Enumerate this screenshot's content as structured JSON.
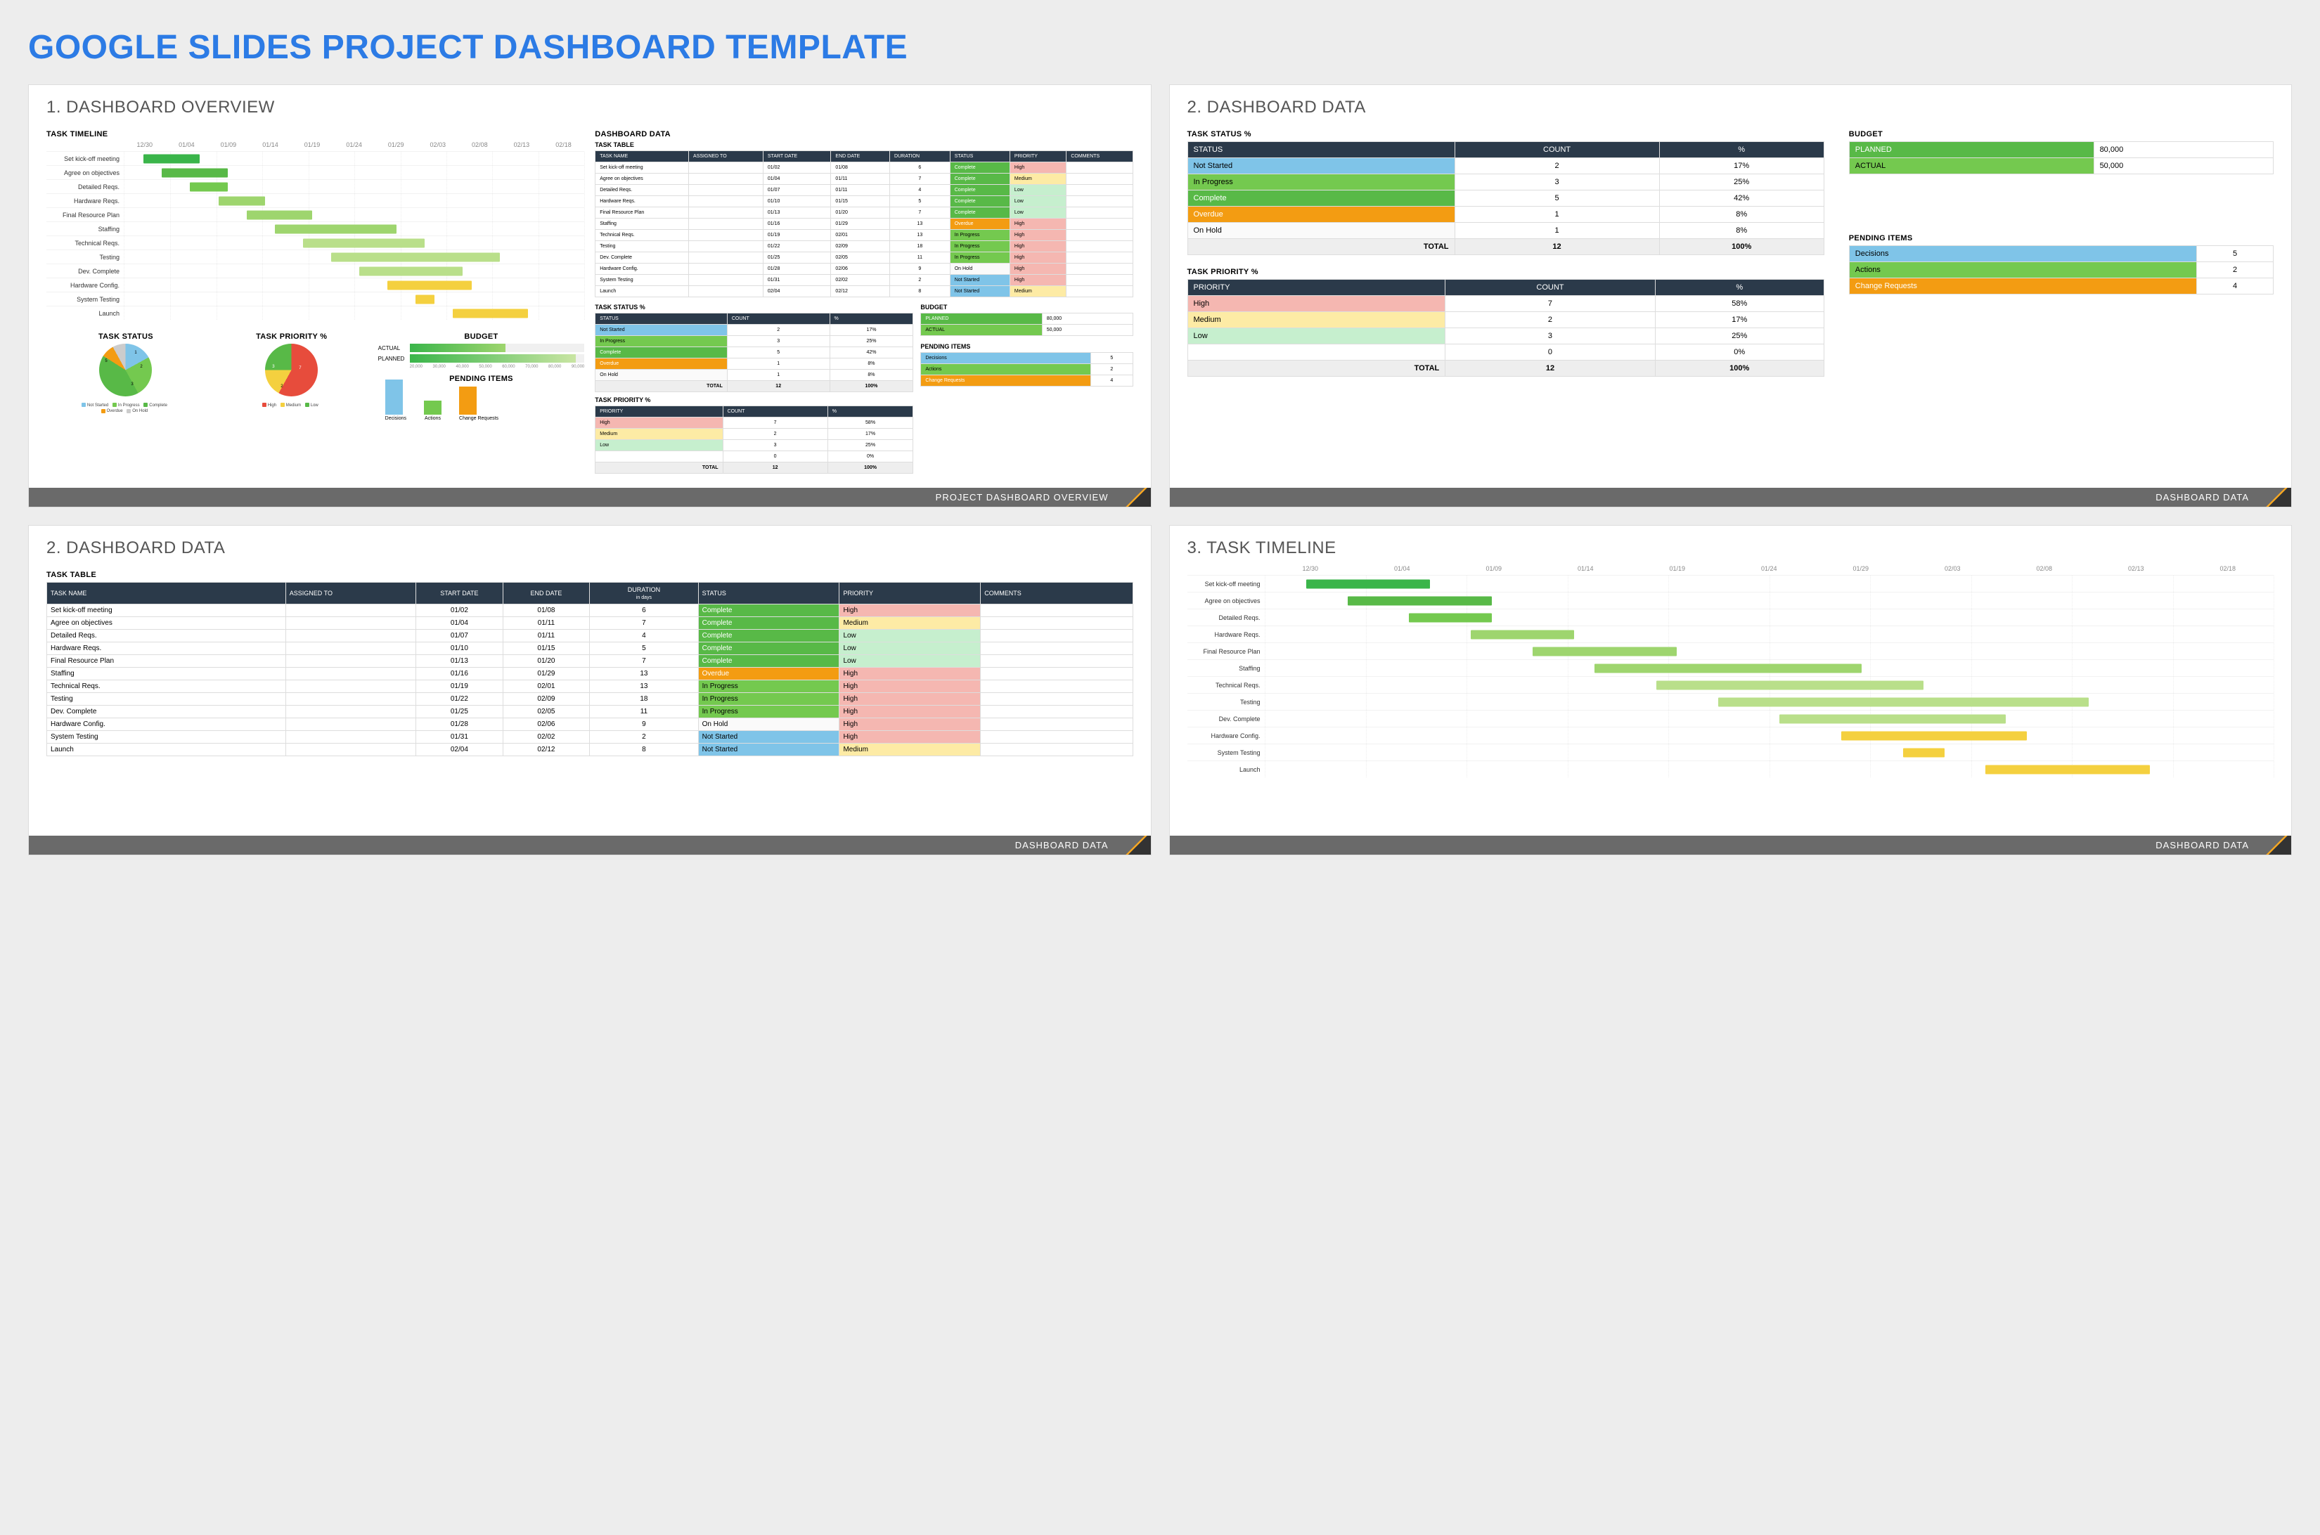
{
  "page_title": "GOOGLE SLIDES PROJECT DASHBOARD TEMPLATE",
  "colors": {
    "status": {
      "Not Started": "#7FC4E8",
      "In Progress": "#74C94F",
      "Complete": "#58B947",
      "Overdue": "#F39C12",
      "On Hold": "#FAFAFA"
    },
    "priority": {
      "High": "#F5B7B1",
      "Medium": "#FDEBA5",
      "Low": "#C6EFCE"
    },
    "gantt": [
      "#3AB54A",
      "#58B947",
      "#74C94F",
      "#9ED56E",
      "#9ED56E",
      "#9ED56E",
      "#B9DF8A",
      "#B9DF8A",
      "#B9DF8A",
      "#F4D03F",
      "#F4D03F",
      "#F4D03F"
    ]
  },
  "panels": {
    "overview": {
      "title": "1. DASHBOARD OVERVIEW",
      "footer": "PROJECT DASHBOARD OVERVIEW",
      "sections": {
        "timeline": "TASK TIMELINE",
        "data": "DASHBOARD DATA",
        "status": "TASK STATUS",
        "priority": "TASK PRIORITY %",
        "budget": "BUDGET",
        "pending": "PENDING ITEMS",
        "status_pct": "TASK STATUS %",
        "priority_pct": "TASK PRIORITY %",
        "task_table": "TASK TABLE"
      },
      "budget_axis": [
        "20,000",
        "30,000",
        "40,000",
        "50,000",
        "60,000",
        "70,000",
        "80,000",
        "90,000"
      ],
      "budget_bars": {
        "ACTUAL": "ACTUAL",
        "PLANNED": "PLANNED"
      },
      "legend_status": [
        "Not Started",
        "In Progress",
        "Complete",
        "Overdue",
        "On Hold"
      ],
      "legend_priority": [
        "High",
        "Medium",
        "Low"
      ],
      "pending_labels": [
        "Decisions",
        "Actions",
        "Change Requests"
      ]
    },
    "data_right": {
      "title": "2. DASHBOARD DATA",
      "footer": "DASHBOARD DATA",
      "task_status": {
        "heading": "TASK STATUS %",
        "cols": [
          "STATUS",
          "COUNT",
          "%"
        ],
        "rows": [
          {
            "status": "Not Started",
            "count": 2,
            "pct": "17%",
            "cls": "status-notstarted"
          },
          {
            "status": "In Progress",
            "count": 3,
            "pct": "25%",
            "cls": "status-inprogress"
          },
          {
            "status": "Complete",
            "count": 5,
            "pct": "42%",
            "cls": "status-complete"
          },
          {
            "status": "Overdue",
            "count": 1,
            "pct": "8%",
            "cls": "status-overdue"
          },
          {
            "status": "On Hold",
            "count": 1,
            "pct": "8%",
            "cls": "status-onhold"
          }
        ],
        "total_label": "TOTAL",
        "total_count": 12,
        "total_pct": "100%"
      },
      "task_priority": {
        "heading": "TASK PRIORITY %",
        "cols": [
          "PRIORITY",
          "COUNT",
          "%"
        ],
        "rows": [
          {
            "priority": "High",
            "count": 7,
            "pct": "58%",
            "cls": "prio-high"
          },
          {
            "priority": "Medium",
            "count": 2,
            "pct": "17%",
            "cls": "prio-med"
          },
          {
            "priority": "Low",
            "count": 3,
            "pct": "25%",
            "cls": "prio-low"
          },
          {
            "priority": "",
            "count": 0,
            "pct": "0%",
            "cls": ""
          }
        ],
        "total_label": "TOTAL",
        "total_count": 12,
        "total_pct": "100%"
      },
      "budget": {
        "heading": "BUDGET",
        "rows": [
          {
            "label": "PLANNED",
            "value": "80,000",
            "cls": "budget-planned"
          },
          {
            "label": "ACTUAL",
            "value": "50,000",
            "cls": "budget-actual"
          }
        ]
      },
      "pending": {
        "heading": "PENDING ITEMS",
        "rows": [
          {
            "label": "Decisions",
            "value": 5,
            "cls": "pi-dec"
          },
          {
            "label": "Actions",
            "value": 2,
            "cls": "pi-act"
          },
          {
            "label": "Change Requests",
            "value": 4,
            "cls": "pi-chg"
          }
        ]
      }
    },
    "data_left": {
      "title": "2. DASHBOARD DATA",
      "footer": "DASHBOARD DATA",
      "heading": "TASK TABLE",
      "cols": [
        "TASK NAME",
        "ASSIGNED TO",
        "START DATE",
        "END DATE",
        "DURATION\nin days",
        "STATUS",
        "PRIORITY",
        "COMMENTS"
      ],
      "rows": [
        {
          "name": "Set kick-off meeting",
          "assigned": "",
          "start": "01/02",
          "end": "01/08",
          "dur": 6,
          "status": "Complete",
          "prio": "High"
        },
        {
          "name": "Agree on objectives",
          "assigned": "",
          "start": "01/04",
          "end": "01/11",
          "dur": 7,
          "status": "Complete",
          "prio": "Medium"
        },
        {
          "name": "Detailed Reqs.",
          "assigned": "",
          "start": "01/07",
          "end": "01/11",
          "dur": 4,
          "status": "Complete",
          "prio": "Low"
        },
        {
          "name": "Hardware Reqs.",
          "assigned": "",
          "start": "01/10",
          "end": "01/15",
          "dur": 5,
          "status": "Complete",
          "prio": "Low"
        },
        {
          "name": "Final Resource Plan",
          "assigned": "",
          "start": "01/13",
          "end": "01/20",
          "dur": 7,
          "status": "Complete",
          "prio": "Low"
        },
        {
          "name": "Staffing",
          "assigned": "",
          "start": "01/16",
          "end": "01/29",
          "dur": 13,
          "status": "Overdue",
          "prio": "High"
        },
        {
          "name": "Technical Reqs.",
          "assigned": "",
          "start": "01/19",
          "end": "02/01",
          "dur": 13,
          "status": "In Progress",
          "prio": "High"
        },
        {
          "name": "Testing",
          "assigned": "",
          "start": "01/22",
          "end": "02/09",
          "dur": 18,
          "status": "In Progress",
          "prio": "High"
        },
        {
          "name": "Dev. Complete",
          "assigned": "",
          "start": "01/25",
          "end": "02/05",
          "dur": 11,
          "status": "In Progress",
          "prio": "High"
        },
        {
          "name": "Hardware Config.",
          "assigned": "",
          "start": "01/28",
          "end": "02/06",
          "dur": 9,
          "status": "On Hold",
          "prio": "High"
        },
        {
          "name": "System Testing",
          "assigned": "",
          "start": "01/31",
          "end": "02/02",
          "dur": 2,
          "status": "Not Started",
          "prio": "High"
        },
        {
          "name": "Launch",
          "assigned": "",
          "start": "02/04",
          "end": "02/12",
          "dur": 8,
          "status": "Not Started",
          "prio": "Medium"
        }
      ]
    },
    "timeline": {
      "title": "3. TASK TIMELINE",
      "footer": "DASHBOARD DATA",
      "dates": [
        "12/30",
        "01/04",
        "01/09",
        "01/14",
        "01/19",
        "01/24",
        "01/29",
        "02/03",
        "02/08",
        "02/13",
        "02/18"
      ],
      "tasks": [
        "Set kick-off meeting",
        "Agree on objectives",
        "Detailed Reqs.",
        "Hardware Reqs.",
        "Final Resource Plan",
        "Staffing",
        "Technical Reqs.",
        "Testing",
        "Dev. Complete",
        "Hardware Config.",
        "System Testing",
        "Launch"
      ]
    }
  },
  "chart_data": [
    {
      "type": "gantt",
      "title": "TASK TIMELINE",
      "x_dates": [
        "12/30",
        "01/04",
        "01/09",
        "01/14",
        "01/19",
        "01/24",
        "01/29",
        "02/03",
        "02/08",
        "02/13",
        "02/18"
      ],
      "tasks": [
        {
          "name": "Set kick-off meeting",
          "start": "01/02",
          "end": "01/08"
        },
        {
          "name": "Agree on objectives",
          "start": "01/04",
          "end": "01/11"
        },
        {
          "name": "Detailed Reqs.",
          "start": "01/07",
          "end": "01/11"
        },
        {
          "name": "Hardware Reqs.",
          "start": "01/10",
          "end": "01/15"
        },
        {
          "name": "Final Resource Plan",
          "start": "01/13",
          "end": "01/20"
        },
        {
          "name": "Staffing",
          "start": "01/16",
          "end": "01/29"
        },
        {
          "name": "Technical Reqs.",
          "start": "01/19",
          "end": "02/01"
        },
        {
          "name": "Testing",
          "start": "01/22",
          "end": "02/09"
        },
        {
          "name": "Dev. Complete",
          "start": "01/25",
          "end": "02/05"
        },
        {
          "name": "Hardware Config.",
          "start": "01/28",
          "end": "02/06"
        },
        {
          "name": "System Testing",
          "start": "01/31",
          "end": "02/02"
        },
        {
          "name": "Launch",
          "start": "02/04",
          "end": "02/12"
        }
      ]
    },
    {
      "type": "pie",
      "title": "TASK STATUS",
      "series": [
        {
          "name": "Not Started",
          "value": 2
        },
        {
          "name": "In Progress",
          "value": 3
        },
        {
          "name": "Complete",
          "value": 5
        },
        {
          "name": "Overdue",
          "value": 1
        },
        {
          "name": "On Hold",
          "value": 1
        }
      ]
    },
    {
      "type": "pie",
      "title": "TASK PRIORITY %",
      "series": [
        {
          "name": "High",
          "value": 7
        },
        {
          "name": "Medium",
          "value": 2
        },
        {
          "name": "Low",
          "value": 3
        }
      ]
    },
    {
      "type": "bar",
      "title": "BUDGET",
      "orientation": "horizontal",
      "categories": [
        "ACTUAL",
        "PLANNED"
      ],
      "values": [
        50000,
        80000
      ],
      "xlim": [
        20000,
        90000
      ]
    },
    {
      "type": "bar",
      "title": "PENDING ITEMS",
      "categories": [
        "Decisions",
        "Actions",
        "Change Requests"
      ],
      "values": [
        5,
        2,
        4
      ]
    }
  ]
}
